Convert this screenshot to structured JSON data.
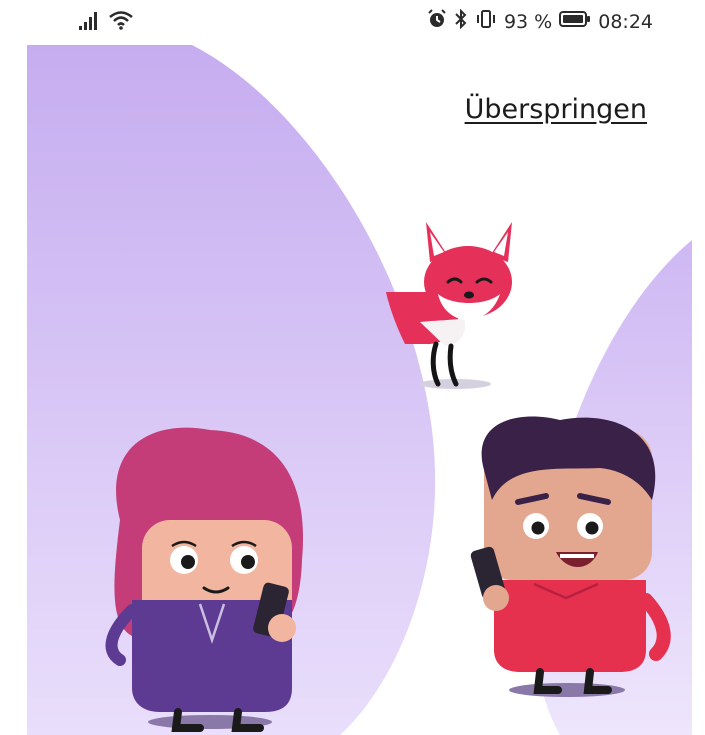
{
  "status_bar": {
    "battery_percent": "93 %",
    "time": "08:24",
    "icons": [
      "signal-icon",
      "wifi-icon",
      "alarm-icon",
      "bluetooth-icon",
      "vibrate-icon",
      "battery-icon"
    ]
  },
  "onboarding": {
    "skip_label": "Überspringen"
  },
  "illustration": {
    "characters": [
      "woman-with-phone",
      "fox",
      "man-with-phone"
    ]
  },
  "colors": {
    "purple_light": "#d9c9f5",
    "purple_mid": "#c6adf0",
    "fox_red": "#e5305a",
    "woman_hair": "#c43d78",
    "woman_shirt": "#5e3b92",
    "man_shirt": "#e5304e",
    "man_hair": "#3a2148",
    "skin": "#f2b6a0"
  }
}
